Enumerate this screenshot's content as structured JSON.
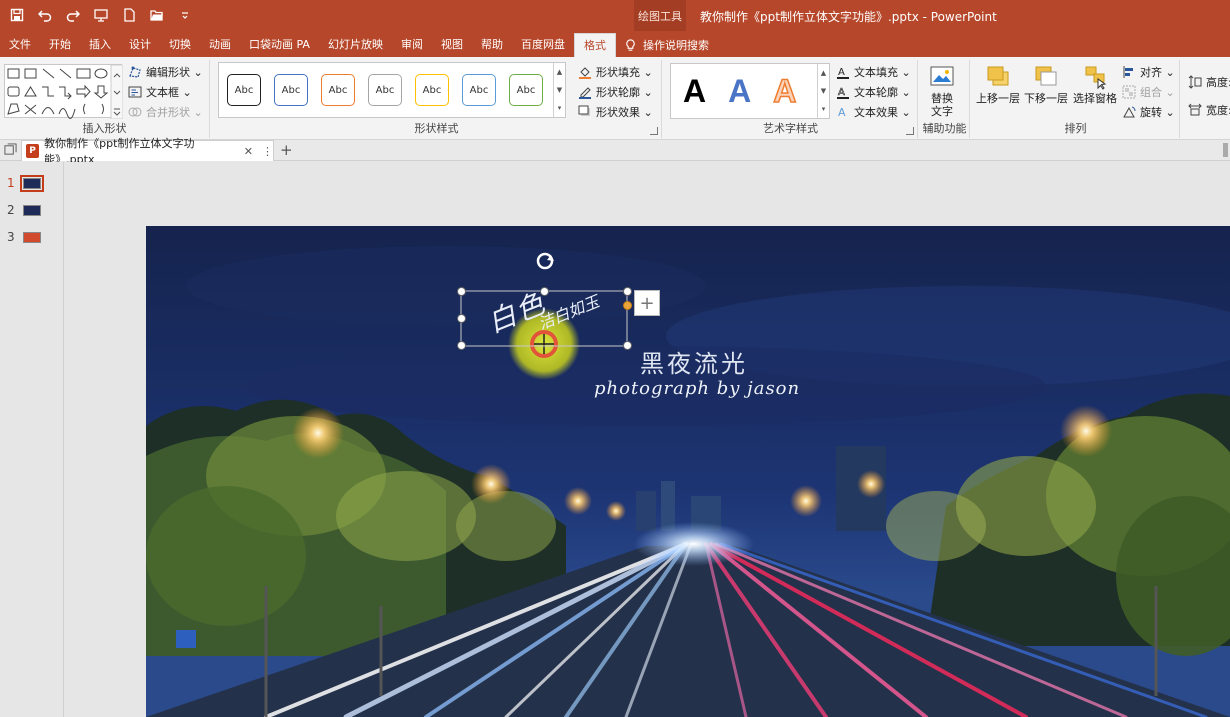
{
  "app": {
    "drawing_tools": "绘图工具",
    "doc_title": "教你制作《ppt制作立体文字功能》.pptx  -  PowerPoint"
  },
  "tabs": [
    {
      "label": "文件"
    },
    {
      "label": "开始"
    },
    {
      "label": "插入"
    },
    {
      "label": "设计"
    },
    {
      "label": "切换"
    },
    {
      "label": "动画"
    },
    {
      "label": "口袋动画 PA"
    },
    {
      "label": "幻灯片放映"
    },
    {
      "label": "审阅"
    },
    {
      "label": "视图"
    },
    {
      "label": "帮助"
    },
    {
      "label": "百度网盘"
    },
    {
      "label": "格式",
      "active": true
    }
  ],
  "tell_me": "操作说明搜索",
  "ribbon": {
    "insert_shapes": {
      "label": "插入形状",
      "edit_shape": "编辑形状 ⌄",
      "text_box": "文本框 ⌄",
      "merge_shapes": "合并形状 ⌄"
    },
    "shape_styles": {
      "label": "形状样式",
      "sample": "Abc",
      "swatches": [
        "#222222",
        "#4472c4",
        "#ed7d31",
        "#a5a5a5",
        "#ffc000",
        "#5b9bd5",
        "#70ad47"
      ],
      "fill": "形状填充 ⌄",
      "outline": "形状轮廓 ⌄",
      "effects": "形状效果 ⌄"
    },
    "wordart": {
      "label": "艺术字样式",
      "letter": "A",
      "text_fill": "文本填充 ⌄",
      "text_outline": "文本轮廓 ⌄",
      "text_effects": "文本效果 ⌄"
    },
    "accessibility": {
      "label": "辅助功能",
      "alt_text_line1": "替换",
      "alt_text_line2": "文字"
    },
    "arrange": {
      "label": "排列",
      "bring_forward": "上移一层",
      "send_backward": "下移一层",
      "selection_pane": "选择窗格",
      "align": "对齐 ⌄",
      "group": "组合 ⌄",
      "rotate": "旋转 ⌄"
    },
    "size": {
      "height": "高度:",
      "width": "宽度:"
    }
  },
  "document_tab": {
    "name": "教你制作《ppt制作立体文字功能》.pptx",
    "close": "✕",
    "more": "⋮",
    "add": "+"
  },
  "slides": [
    {
      "number": "1",
      "selected": true
    },
    {
      "number": "2"
    },
    {
      "number": "3"
    }
  ],
  "slide": {
    "title": "黑夜流光",
    "subtitle": "photograph by jason",
    "selected_text_main": "白色",
    "selected_text_small": "洁白如玉"
  },
  "colors": {
    "accent": "#b7472a",
    "night_sky": "#13204a"
  }
}
